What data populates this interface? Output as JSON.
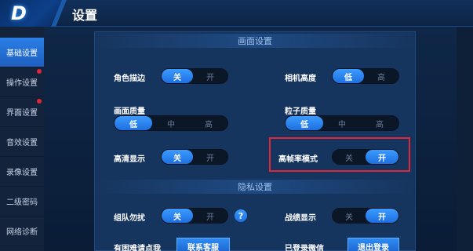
{
  "header": {
    "logo": "D",
    "title": "设置"
  },
  "sidebar": {
    "items": [
      {
        "label": "基础设置",
        "active": true,
        "badge": false
      },
      {
        "label": "操作设置",
        "active": false,
        "badge": true
      },
      {
        "label": "界面设置",
        "active": false,
        "badge": true
      },
      {
        "label": "音效设置",
        "active": false,
        "badge": false
      },
      {
        "label": "录像设置",
        "active": false,
        "badge": false
      },
      {
        "label": "二级密码",
        "active": false,
        "badge": false
      },
      {
        "label": "网络诊断",
        "active": false,
        "badge": false
      }
    ]
  },
  "display": {
    "section_title": "画面设置",
    "outline": {
      "label": "角色描边",
      "off": "关",
      "on": "开",
      "selected": "关"
    },
    "camera_height": {
      "label": "相机高度",
      "low": "低",
      "high": "高",
      "selected": "低"
    },
    "quality": {
      "label": "画面质量",
      "low": "低",
      "mid": "中",
      "high": "高",
      "selected": "低"
    },
    "particle": {
      "label": "粒子质量",
      "low": "低",
      "mid": "中",
      "high": "高",
      "selected": "低"
    },
    "hd": {
      "label": "高清显示",
      "off": "关",
      "on": "开",
      "selected": "关"
    },
    "high_fps": {
      "label": "高帧率模式",
      "off": "关",
      "on": "开",
      "selected": "开"
    }
  },
  "privacy": {
    "section_title": "隐私设置",
    "dnd": {
      "label": "组队勿扰",
      "off": "关",
      "on": "开",
      "selected": "关",
      "help": "?"
    },
    "record": {
      "label": "战绩显示",
      "off": "关",
      "on": "开",
      "selected": "开"
    },
    "help_text": "有困难请点我",
    "contact_button": "联系客服",
    "wechat_status": "已登录微信",
    "logout_button": "退出登录"
  },
  "colors": {
    "accent": "#2a7fe6",
    "highlight": "#e2263a",
    "badge": "#e2263a"
  }
}
